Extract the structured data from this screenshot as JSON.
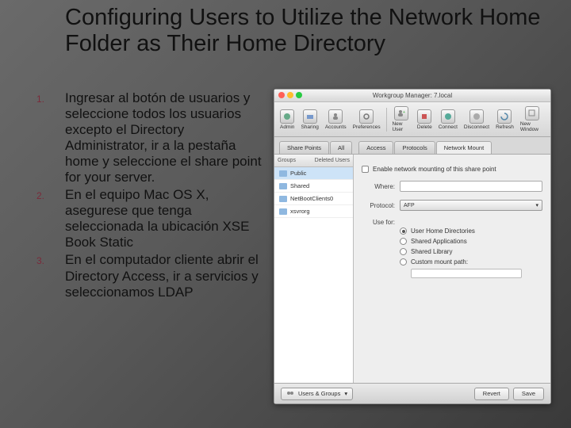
{
  "title": "Configuring Users to Utilize the Network Home Folder as Their Home Directory",
  "list": [
    {
      "num": "1.",
      "text": "Ingresar al botón de usuarios y seleccione todos los usuarios excepto el Directory Administrator, ir a la pestaña home y seleccione el share point for your server."
    },
    {
      "num": "2.",
      "text": "En el equipo Mac OS X, asegurese que tenga seleccionada la ubicación XSE Book Static"
    },
    {
      "num": "3.",
      "text": "En el computador cliente abrir el Directory Access, ir a servicios y seleccionamos LDAP"
    }
  ],
  "screenshot": {
    "window_title": "Workgroup Manager: 7.local",
    "toolbar": [
      "Admin",
      "Sharing",
      "Accounts",
      "Preferences",
      "New User",
      "Delete",
      "Connect",
      "Disconnect",
      "Refresh",
      "New Window"
    ],
    "tabs": [
      "Share Points",
      "All",
      "Access",
      "Protocols",
      "Network Mount"
    ],
    "active_tab": "Network Mount",
    "sidebar": {
      "header_left": "Groups",
      "header_right": "Deleted Users",
      "items": [
        "Public",
        "Shared",
        "NetBootClients0",
        "xsvrorg"
      ],
      "selected": "Public"
    },
    "pane": {
      "enable_label": "Enable network mounting of this share point",
      "where_label": "Where:",
      "protocol_label": "Protocol:",
      "protocol_value": "AFP",
      "use_for_label": "Use for:",
      "radios": [
        {
          "label": "User Home Directories",
          "on": true
        },
        {
          "label": "Shared Applications",
          "on": false
        },
        {
          "label": "Shared Library",
          "on": false
        },
        {
          "label": "Custom mount path:",
          "on": false
        }
      ]
    },
    "footer": {
      "left_select": "Users & Groups",
      "revert": "Revert",
      "save": "Save"
    }
  }
}
